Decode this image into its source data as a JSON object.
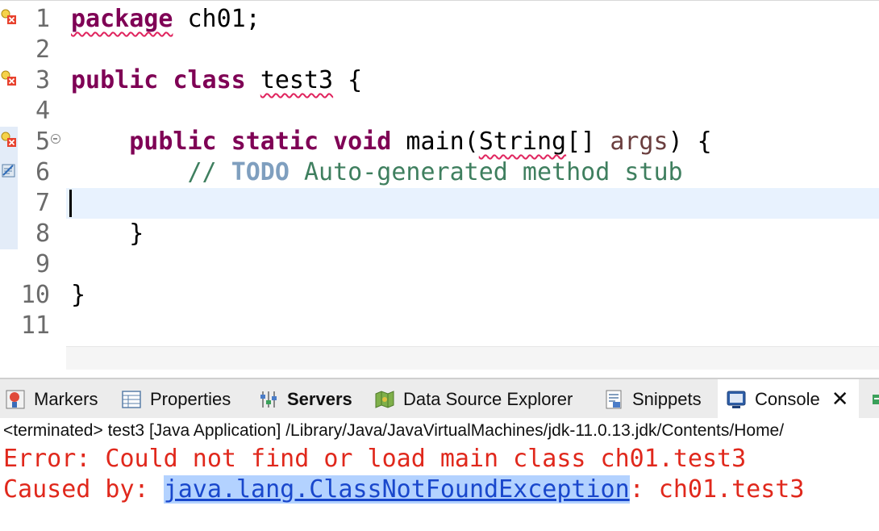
{
  "editor": {
    "line_numbers": [
      "1",
      "2",
      "3",
      "4",
      "5",
      "6",
      "7",
      "8",
      "9",
      "10",
      "11"
    ],
    "lines": {
      "l1": {
        "kw": "package",
        "rest": " ch01;"
      },
      "l3": {
        "kw1": "public",
        "kw2": "class",
        "name": "test3",
        "rest": " {"
      },
      "l5": {
        "indent": "    ",
        "kw1": "public",
        "kw2": "static",
        "kw3": "void",
        "name": " main(",
        "type": "String",
        "mid": "[] ",
        "param": "args",
        "rest": ") {"
      },
      "l6": {
        "indent": "        ",
        "pre": "// ",
        "todo": "TODO",
        "post": " Auto-generated method stub"
      },
      "l8": {
        "text": "    }"
      },
      "l10": {
        "text": "}"
      }
    },
    "markers": {
      "error_icon": "warning-error-icon",
      "task_icon": "task-icon",
      "fold_icon": "fold-collapse-icon"
    }
  },
  "tabs": [
    {
      "label": "Markers",
      "icon": "markers-icon"
    },
    {
      "label": "Properties",
      "icon": "properties-icon"
    },
    {
      "label": "Servers",
      "icon": "servers-icon"
    },
    {
      "label": "Data Source Explorer",
      "icon": "data-source-icon"
    },
    {
      "label": "Snippets",
      "icon": "snippets-icon"
    },
    {
      "label": "Console",
      "icon": "console-icon",
      "close": "✕"
    }
  ],
  "console": {
    "header": "<terminated> test3 [Java Application] /Library/Java/JavaVirtualMachines/jdk-11.0.13.jdk/Contents/Home/",
    "error_line": "Error: Could not find or load main class ch01.test3",
    "caused_prefix": "Caused by: ",
    "exception_link": "java.lang.ClassNotFoundException",
    "caused_suffix": ": ch01.test3"
  },
  "colors": {
    "keyword": "#7f0055",
    "comment": "#3f7f5f",
    "todo": "#7f9fbf",
    "error_text": "#e0281c",
    "link": "#1947cc"
  }
}
